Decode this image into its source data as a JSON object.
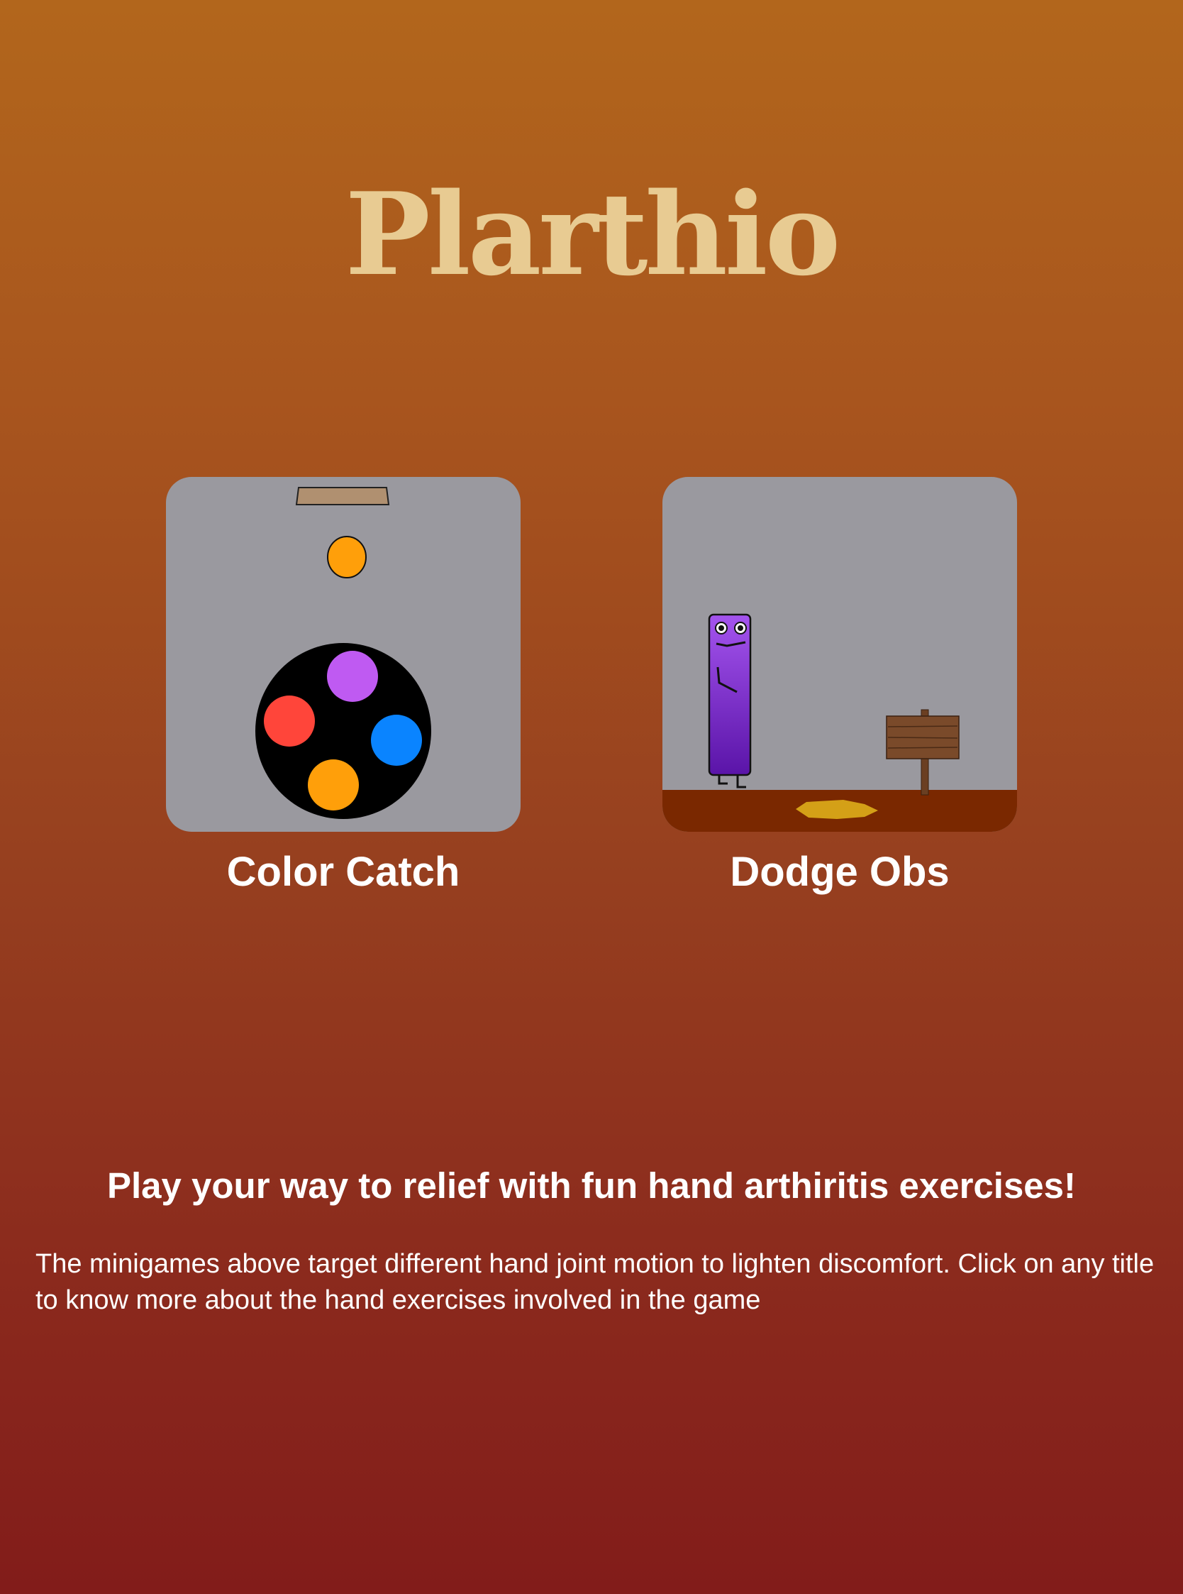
{
  "header": {
    "title": "Plarthio"
  },
  "games": [
    {
      "title": "Color Catch",
      "icons": [
        "paddle-icon",
        "falling-ball-icon",
        "color-wheel-icon"
      ],
      "colors": {
        "ball": "#ff9f0a",
        "purple": "#bf5af2",
        "red": "#ff453a",
        "blue": "#0a84ff",
        "orange": "#ff9f0a"
      }
    },
    {
      "title": "Dodge Obs",
      "icons": [
        "purple-character-icon",
        "wooden-sign-icon",
        "puddle-icon"
      ],
      "colors": {
        "character": "#8a3ee0",
        "ground": "#7a2800",
        "puddle": "#d4a017",
        "sign": "#7a4a2a"
      }
    }
  ],
  "info": {
    "tagline": "Play your way to relief with fun hand arthiritis exercises!",
    "description": "The minigames above target different hand joint motion to lighten discomfort. Click on any title to know more about the hand exercises involved in the game"
  }
}
